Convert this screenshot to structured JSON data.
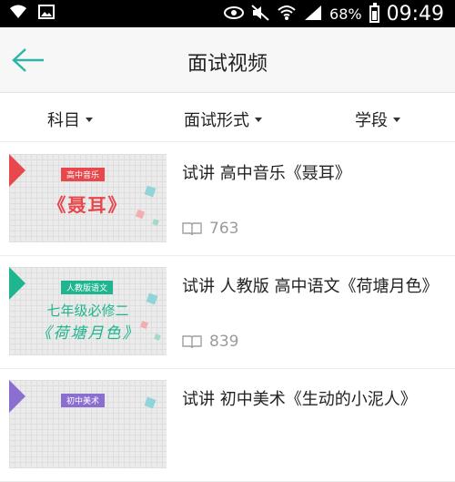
{
  "status_bar": {
    "battery": "68%",
    "time": "09:49",
    "left_icons": [
      "wifi-icon",
      "image-icon"
    ],
    "right_icons": [
      "eye-icon",
      "mute-icon",
      "wifi-icon",
      "signal-icon",
      "battery-icon"
    ],
    "battery_level": 0.68
  },
  "header": {
    "title": "面试视频",
    "back_icon": "arrow-left-icon",
    "accent": "#2bb5a7"
  },
  "filters": [
    "科目",
    "面试形式",
    "学段"
  ],
  "videos": [
    {
      "title": "试讲 高中音乐《聂耳》",
      "views": "763",
      "thumb": {
        "badge": "高中音乐",
        "caption": "《聂耳》",
        "caption2": "",
        "flag_color": "#e8474b",
        "badge_color": "#e8474b",
        "caption_color": "#e8474b"
      }
    },
    {
      "title": "试讲 人教版 高中语文《荷塘月色》",
      "views": "839",
      "thumb": {
        "badge": "人教版语文",
        "caption": "七年级必修二",
        "caption2": "《荷塘月色》",
        "flag_color": "#1fb58f",
        "badge_color": "#1fb58f",
        "caption_color": "#1fb58f"
      }
    },
    {
      "title": "试讲 初中美术《生动的小泥人》",
      "views": "",
      "thumb": {
        "badge": "初中美术",
        "caption": "",
        "caption2": "",
        "flag_color": "#8a6fd1",
        "badge_color": "#8a6fd1",
        "caption_color": "#8a6fd1"
      }
    }
  ],
  "view_icon": "book-icon"
}
